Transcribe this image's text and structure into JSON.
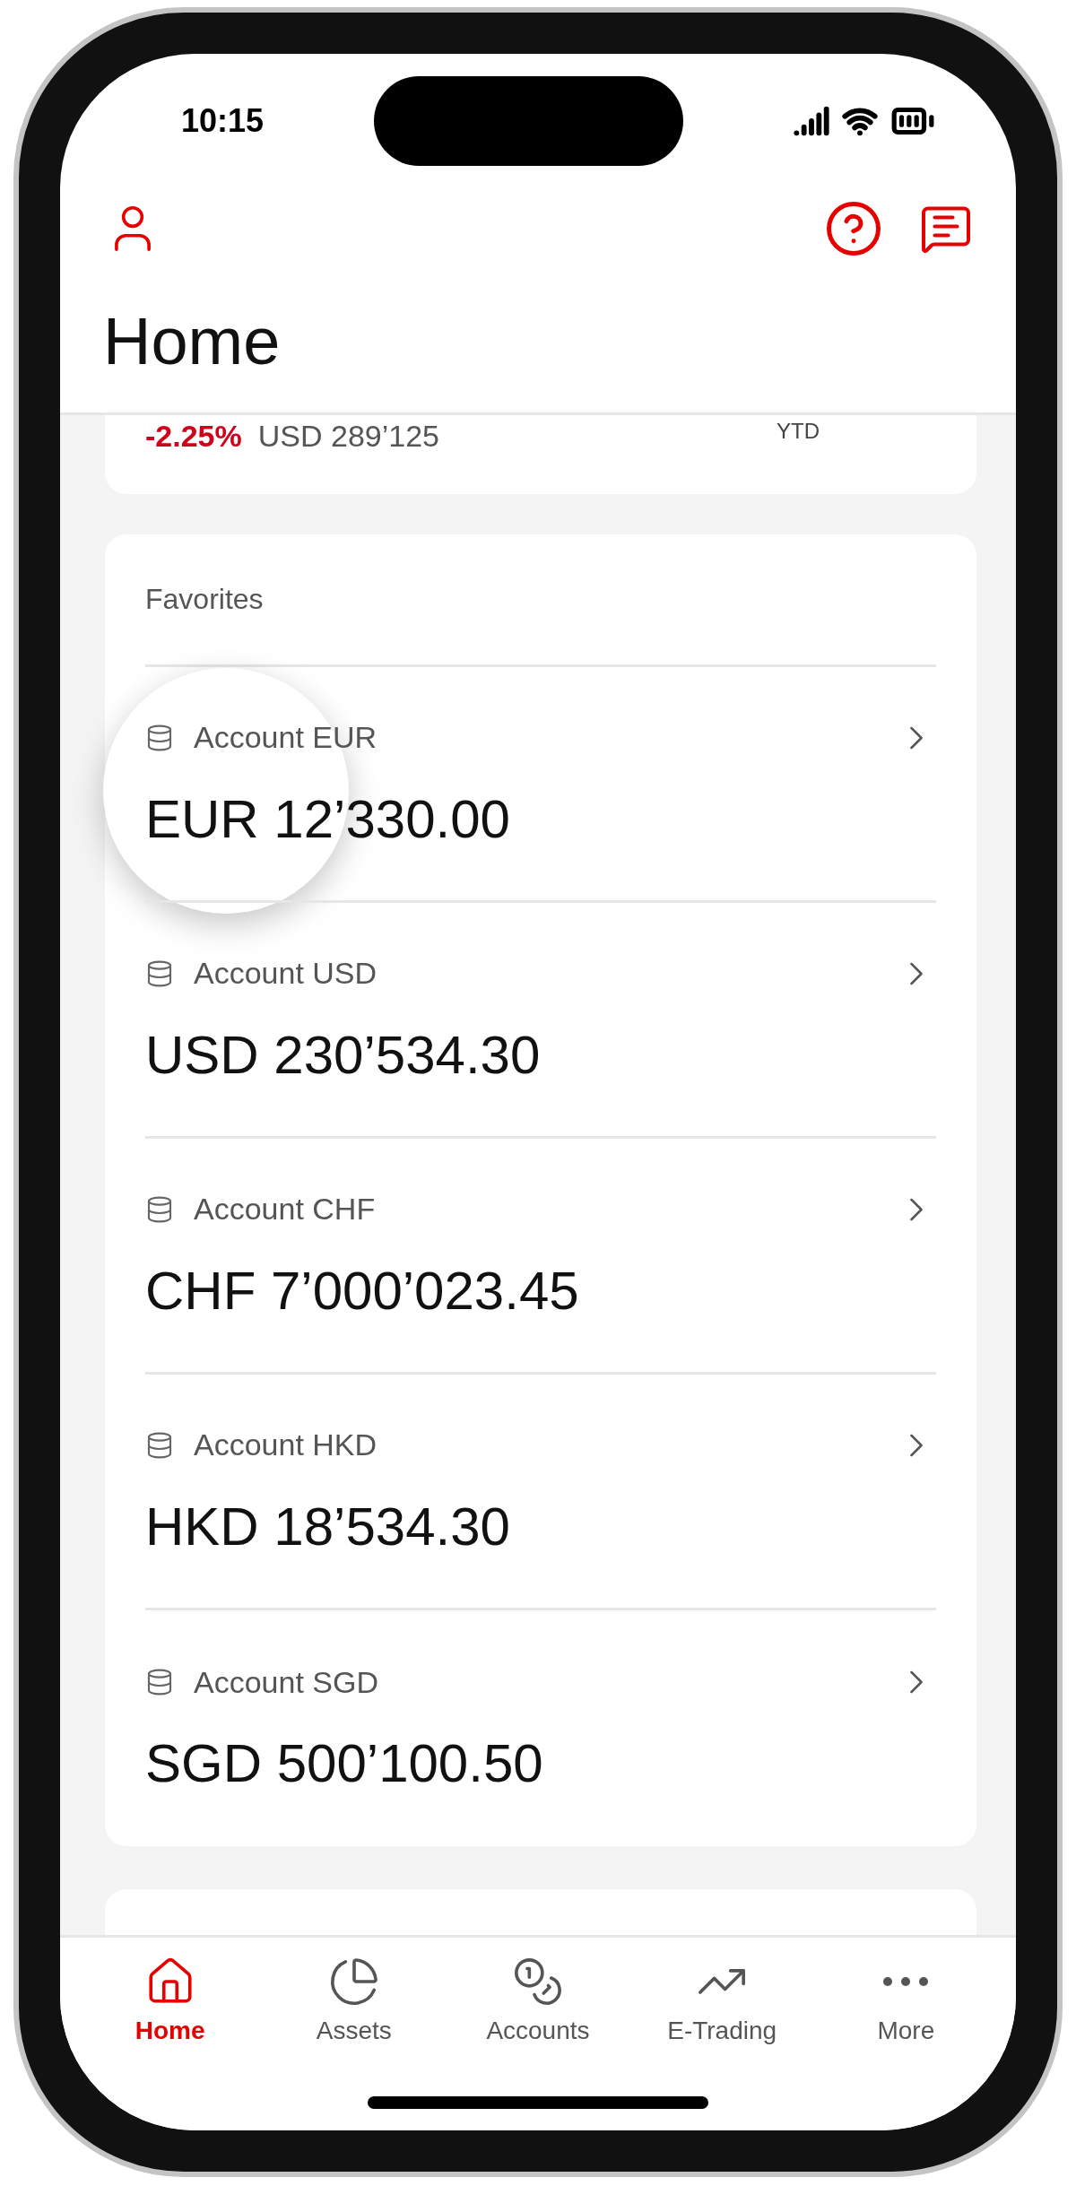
{
  "status_bar": {
    "time": "10:15"
  },
  "header": {
    "title": "Home"
  },
  "summary": {
    "change": "-2.25%",
    "value": "USD 289’125",
    "period": "YTD"
  },
  "favorites": {
    "title": "Favorites",
    "accounts": [
      {
        "name": "Account EUR",
        "amount": "EUR 12’330.00"
      },
      {
        "name": "Account USD",
        "amount": "USD 230’534.30"
      },
      {
        "name": "Account CHF",
        "amount": "CHF 7’000’023.45"
      },
      {
        "name": "Account HKD",
        "amount": "HKD 18’534.30"
      },
      {
        "name": "Account SGD",
        "amount": "SGD 500’100.50"
      }
    ]
  },
  "tab_bar": [
    {
      "label": "Home",
      "selected": true
    },
    {
      "label": "Assets",
      "selected": false
    },
    {
      "label": "Accounts",
      "selected": false
    },
    {
      "label": "E-Trading",
      "selected": false
    },
    {
      "label": "More",
      "selected": false
    }
  ]
}
